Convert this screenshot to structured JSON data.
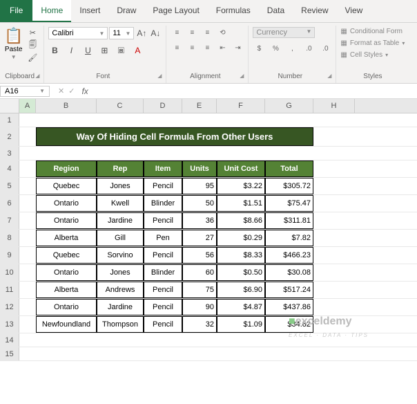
{
  "tabs": {
    "file": "File",
    "home": "Home",
    "insert": "Insert",
    "draw": "Draw",
    "page_layout": "Page Layout",
    "formulas": "Formulas",
    "data": "Data",
    "review": "Review",
    "view": "View"
  },
  "ribbon": {
    "clipboard": {
      "label": "Clipboard",
      "paste": "Paste"
    },
    "font": {
      "label": "Font",
      "name": "Calibri",
      "size": "11",
      "bold": "B",
      "italic": "I",
      "underline": "U"
    },
    "alignment": {
      "label": "Alignment"
    },
    "number": {
      "label": "Number",
      "format": "Currency"
    },
    "styles": {
      "label": "Styles",
      "conditional": "Conditional Form",
      "table": "Format as Table",
      "cell": "Cell Styles"
    }
  },
  "namebox": "A16",
  "formula": "",
  "columns": [
    "A",
    "B",
    "C",
    "D",
    "E",
    "F",
    "G",
    "H"
  ],
  "row_nums": [
    "1",
    "2",
    "3",
    "4",
    "5",
    "6",
    "7",
    "8",
    "9",
    "10",
    "11",
    "12",
    "13",
    "14",
    "15"
  ],
  "title": "Way Of Hiding Cell Formula From Other Users",
  "headers": [
    "Region",
    "Rep",
    "Item",
    "Units",
    "Unit Cost",
    "Total"
  ],
  "data": [
    [
      "Quebec",
      "Jones",
      "Pencil",
      "95",
      "$3.22",
      "$305.72"
    ],
    [
      "Ontario",
      "Kwell",
      "Blinder",
      "50",
      "$1.51",
      "$75.47"
    ],
    [
      "Ontario",
      "Jardine",
      "Pencil",
      "36",
      "$8.66",
      "$311.81"
    ],
    [
      "Alberta",
      "Gill",
      "Pen",
      "27",
      "$0.29",
      "$7.82"
    ],
    [
      "Quebec",
      "Sorvino",
      "Pencil",
      "56",
      "$8.33",
      "$466.23"
    ],
    [
      "Ontario",
      "Jones",
      "Blinder",
      "60",
      "$0.50",
      "$30.08"
    ],
    [
      "Alberta",
      "Andrews",
      "Pencil",
      "75",
      "$6.90",
      "$517.24"
    ],
    [
      "Ontario",
      "Jardine",
      "Pencil",
      "90",
      "$4.87",
      "$437.86"
    ],
    [
      "Newfoundland",
      "Thompson",
      "Pencil",
      "32",
      "$1.09",
      "$34.82"
    ]
  ],
  "watermark": {
    "main": "exceldemy",
    "sub": "EXCEL · DATA · TIPS"
  }
}
